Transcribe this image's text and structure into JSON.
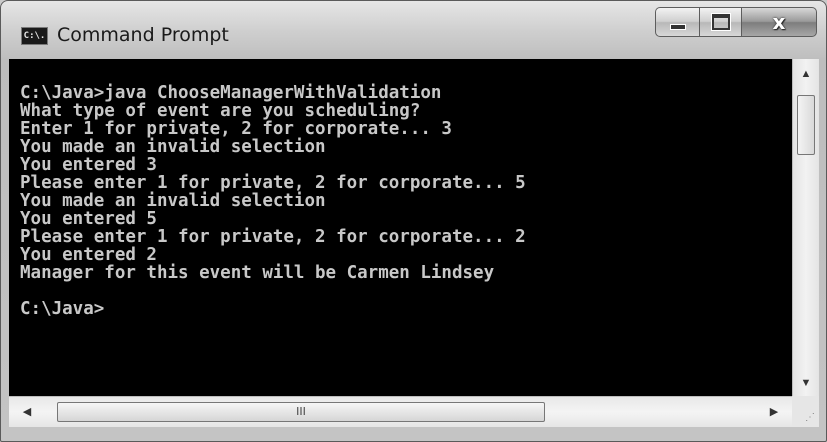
{
  "window": {
    "title": "Command Prompt",
    "icon_label": "C:\\."
  },
  "caption_buttons": {
    "minimize": "minimize-icon",
    "maximize": "maximize-icon",
    "close": "x"
  },
  "console": {
    "lines": [
      "C:\\Java>java ChooseManagerWithValidation",
      "What type of event are you scheduling?",
      "Enter 1 for private, 2 for corporate... 3",
      "You made an invalid selection",
      "You entered 3",
      "Please enter 1 for private, 2 for corporate... 5",
      "You made an invalid selection",
      "You entered 5",
      "Please enter 1 for private, 2 for corporate... 2",
      "You entered 2",
      "Manager for this event will be Carmen Lindsey",
      "",
      "C:\\Java>"
    ]
  },
  "scrollbars": {
    "up_arrow": "▲",
    "down_arrow": "▼",
    "left_arrow": "◀",
    "right_arrow": "▶",
    "hthumb_grip": "III"
  },
  "colors": {
    "console_bg": "#000000",
    "console_fg": "#c8c8c8"
  }
}
